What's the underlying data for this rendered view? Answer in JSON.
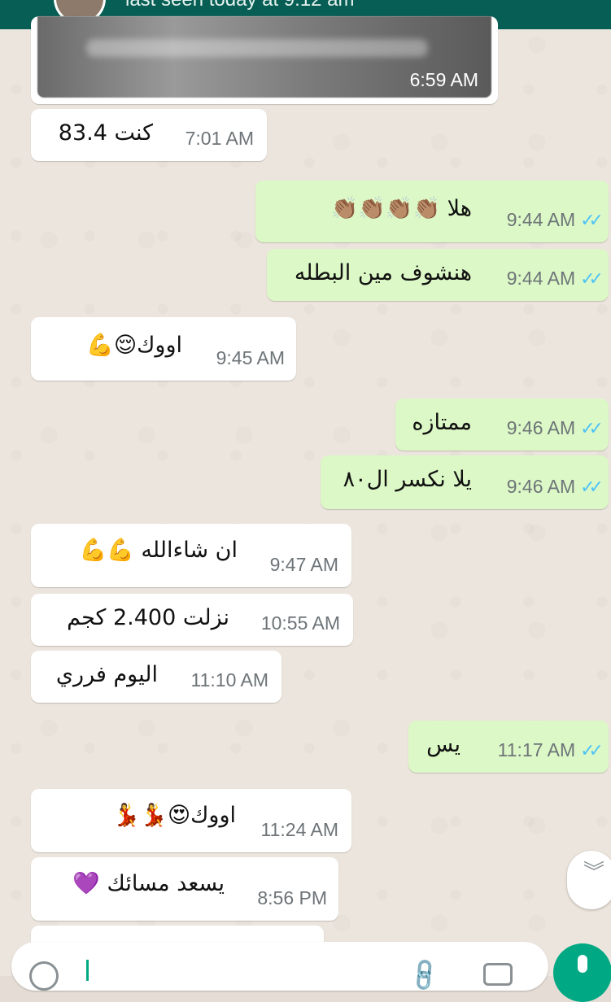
{
  "header": {
    "subtitle": "last seen today at 9:12 am"
  },
  "media_message": {
    "time": "6:59 AM"
  },
  "messages": [
    {
      "dir": "in",
      "text": "كنت 83.4",
      "time": "7:01 AM"
    },
    {
      "dir": "out",
      "text": "هلا 👏🏽👏🏽👏🏽👏🏽",
      "time": "9:44 AM",
      "read": true
    },
    {
      "dir": "out",
      "text": "هنشوف مين البطله",
      "time": "9:44 AM",
      "read": true
    },
    {
      "dir": "in",
      "text": "اووك😌💪",
      "time": "9:45 AM"
    },
    {
      "dir": "out",
      "text": "ممتازه",
      "time": "9:46 AM",
      "read": true
    },
    {
      "dir": "out",
      "text": "يلا نكسر ال٨٠",
      "time": "9:46 AM",
      "read": true
    },
    {
      "dir": "in",
      "text": "ان شاءالله 💪💪",
      "time": "9:47 AM"
    },
    {
      "dir": "in",
      "text": "نزلت 2.400 كجم",
      "time": "10:55 AM"
    },
    {
      "dir": "in",
      "text": "اليوم فرري",
      "time": "11:10 AM"
    },
    {
      "dir": "out",
      "text": "يس",
      "time": "11:17 AM",
      "read": true
    },
    {
      "dir": "in",
      "text": "اووك😍💃💃",
      "time": "11:24 AM"
    },
    {
      "dir": "in",
      "text": "يسعد مسائك 💜",
      "time": "8:56 PM"
    }
  ],
  "ticks_glyph": "✓✓",
  "icons": {
    "scroll_down": "chevron-down-icon",
    "emoji": "emoji-icon",
    "attach": "paperclip-icon",
    "camera": "camera-icon",
    "mic": "mic-icon"
  },
  "colors": {
    "header": "#075e54",
    "outgoing_bubble": "#dcf8c6",
    "incoming_bubble": "#ffffff",
    "read_ticks": "#4fc3f7",
    "accent": "#00a884"
  }
}
